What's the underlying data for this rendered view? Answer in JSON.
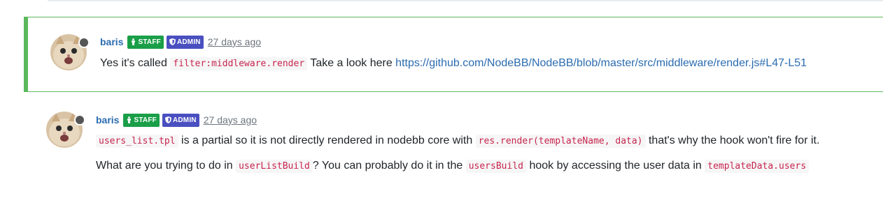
{
  "posts": [
    {
      "username": "baris",
      "badges": {
        "staff": "STAFF",
        "admin": "ADMIN"
      },
      "timeago": "27 days ago",
      "highlighted": true,
      "p1": {
        "t1": "Yes it's called",
        "c1": "filter:middleware.render",
        "t2": "Take a look here",
        "link": "https://github.com/NodeBB/NodeBB/blob/master/src/middleware/render.js#L47-L51"
      }
    },
    {
      "username": "baris",
      "badges": {
        "staff": "STAFF",
        "admin": "ADMIN"
      },
      "timeago": "27 days ago",
      "highlighted": false,
      "p1": {
        "c1": "users_list.tpl",
        "t1": "is a partial so it is not directly rendered in nodebb core with",
        "c2": "res.render(templateName, data)",
        "t2": "that's why the hook won't fire for it."
      },
      "p2": {
        "t1": "What are you trying to do in",
        "c1": "userListBuild",
        "t2": "? You can probably do it in the",
        "c2": "usersBuild",
        "t3": "hook by accessing the user data in",
        "c3": "templateData.users"
      }
    }
  ],
  "colors": {
    "highlight_border": "#5cb85c",
    "staff_badge": "#1a9f48",
    "admin_badge": "#4a4fc0",
    "link": "#2b6cb0",
    "code": "#c7254e"
  },
  "icons": {
    "staff": "person-standing-icon",
    "admin": "shield-icon",
    "status": "offline-status-dot"
  }
}
